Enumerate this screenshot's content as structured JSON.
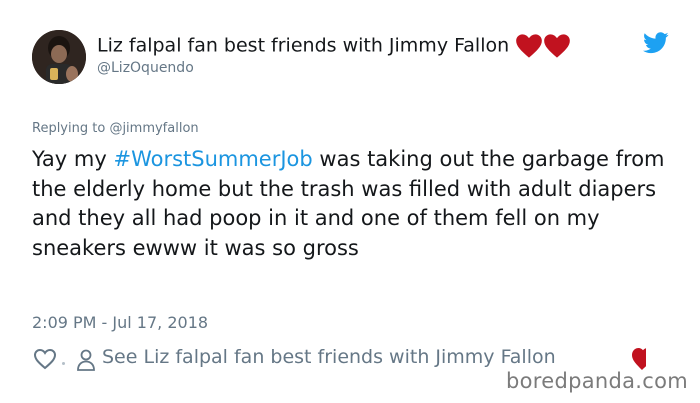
{
  "tweet": {
    "author_name": "Liz falpal fan best friends with Jimmy Fallon",
    "author_handle": "@LizOquendo",
    "reply_label": "Replying to",
    "reply_handle": "@jimmyfallon",
    "text_before": "Yay my ",
    "hashtag": "#WorstSummerJob",
    "text_after": " was taking out the garbage  from the elderly  home but the trash was filled with adult diapers  and they all had poop in it and one of them fell on my sneakers  ewww it was so gross",
    "timestamp": "2:09 PM - Jul 17, 2018",
    "see_more_label": "See Liz falpal fan best friends with Jimmy Fallon"
  },
  "icons": {
    "heart_emoji": "heart-icon",
    "brand": "twitter-bird-icon",
    "like": "like-heart-icon",
    "profile": "person-icon"
  },
  "colors": {
    "heart": "#c1121f",
    "twitter_blue": "#1da1f2",
    "hashtag": "#1b95e0",
    "muted": "#657786"
  },
  "watermark": "boredpanda.com"
}
